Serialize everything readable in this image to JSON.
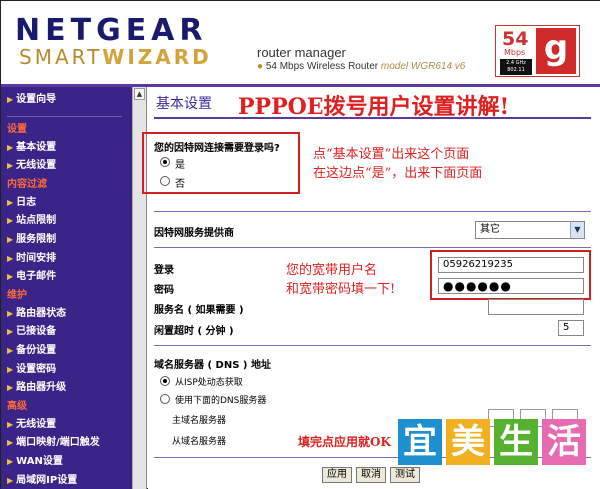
{
  "header": {
    "logo_top": "NETGEAR",
    "logo_bottom_a": "SMART",
    "logo_bottom_b": "WIZARD",
    "title": "router manager",
    "subtitle": "54 Mbps Wireless Router",
    "model": "model WGR614 v6",
    "badge_num": "54",
    "badge_mbps": "Mbps",
    "badge_ghz": "2.4 GHz 802.11",
    "badge_letter": "g"
  },
  "sidebar": {
    "items": [
      {
        "type": "item",
        "label": "设置向导"
      },
      {
        "type": "sep"
      },
      {
        "type": "head",
        "label": "设置"
      },
      {
        "type": "item",
        "label": "基本设置"
      },
      {
        "type": "item",
        "label": "无线设置"
      },
      {
        "type": "head",
        "label": "内容过滤"
      },
      {
        "type": "item",
        "label": "日志"
      },
      {
        "type": "item",
        "label": "站点限制"
      },
      {
        "type": "item",
        "label": "服务限制"
      },
      {
        "type": "item",
        "label": "时间安排"
      },
      {
        "type": "item",
        "label": "电子邮件"
      },
      {
        "type": "head",
        "label": "维护"
      },
      {
        "type": "item",
        "label": "路由器状态"
      },
      {
        "type": "item",
        "label": "已接设备"
      },
      {
        "type": "item",
        "label": "备份设置"
      },
      {
        "type": "item",
        "label": "设置密码"
      },
      {
        "type": "item",
        "label": "路由器升级"
      },
      {
        "type": "head",
        "label": "高级"
      },
      {
        "type": "item",
        "label": "无线设置"
      },
      {
        "type": "item",
        "label": "端口映射/端口触发"
      },
      {
        "type": "item",
        "label": "WAN设置"
      },
      {
        "type": "item",
        "label": "局域网IP设置"
      }
    ]
  },
  "main": {
    "page_title": "基本设置",
    "annotation_title": "PPPOE拨号用户设置讲解!",
    "question": "您的因特网连接需要登录吗?",
    "yes": "是",
    "no": "否",
    "hint_line1": "点“基本设置”出来这个页面",
    "hint_line2": "在这边点“是”，出来下面页面",
    "isp_label": "因特网服务提供商",
    "isp_value": "其它",
    "login_label": "登录",
    "login_value": "05926219235",
    "password_label": "密码",
    "password_value": "●●●●●●",
    "user_hint_line1": "您的宽带用户名",
    "user_hint_line2": "和宽带密码填一下!",
    "service_label": "服务名 ( 如果需要 )",
    "idle_label": "闲置超时 ( 分钟 )",
    "idle_value": "5",
    "dns_title": "域名服务器 ( DNS ) 地址",
    "dns_auto": "从ISP处动态获取",
    "dns_manual": "使用下面的DNS服务器",
    "dns_primary": "主域名服务器",
    "dns_secondary": "从域名服务器",
    "apply_hint": "填完点应用就OK",
    "apply": "应用",
    "cancel": "取消",
    "test": "测试"
  },
  "watermark": [
    "宜",
    "美",
    "生",
    "活"
  ],
  "colors": {
    "sidebar": "#3b2487",
    "accent": "#d02020",
    "title": "#3b2aa0"
  }
}
